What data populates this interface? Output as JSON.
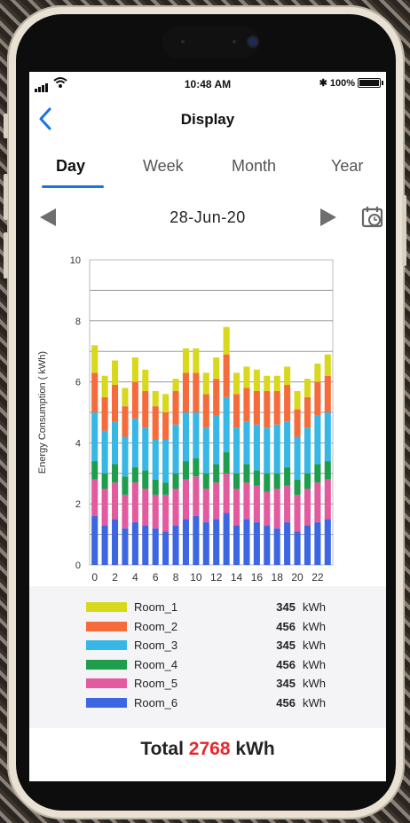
{
  "status": {
    "time": "10:48 AM",
    "battery": "100%",
    "battery_level": 1.0
  },
  "header": {
    "title": "Display"
  },
  "tabs": [
    {
      "label": "Day",
      "active": true
    },
    {
      "label": "Week",
      "active": false
    },
    {
      "label": "Month",
      "active": false
    },
    {
      "label": "Year",
      "active": false
    }
  ],
  "date": {
    "label": "28-Jun-20"
  },
  "icons": {
    "back": "chevron-left-icon",
    "prev": "triangle-left-icon",
    "next": "triangle-right-icon",
    "calendar": "calendar-clock-icon"
  },
  "chart_data": {
    "type": "bar",
    "stacked": true,
    "ylabel": "Energy Consumption ( kWh)",
    "ylim": [
      0,
      10
    ],
    "yticks": [
      0,
      2,
      4,
      6,
      8,
      10
    ],
    "xtick_labels": [
      "0",
      "2",
      "4",
      "6",
      "8",
      "10",
      "12",
      "14",
      "16",
      "18",
      "20",
      "22"
    ],
    "grid": true,
    "categories": [
      0,
      1,
      2,
      3,
      4,
      5,
      6,
      7,
      8,
      9,
      10,
      11,
      12,
      13,
      14,
      15,
      16,
      17,
      18,
      19,
      20,
      21,
      22,
      23
    ],
    "series": [
      {
        "name": "Room_6",
        "color": "#3d66e3",
        "values": [
          1.6,
          1.3,
          1.5,
          1.2,
          1.4,
          1.3,
          1.2,
          1.1,
          1.3,
          1.5,
          1.6,
          1.4,
          1.5,
          1.7,
          1.3,
          1.5,
          1.4,
          1.3,
          1.2,
          1.4,
          1.1,
          1.3,
          1.4,
          1.5
        ]
      },
      {
        "name": "Room_5",
        "color": "#e35a9e",
        "values": [
          1.2,
          1.2,
          1.2,
          1.1,
          1.3,
          1.2,
          1.1,
          1.2,
          1.2,
          1.3,
          1.3,
          1.1,
          1.2,
          1.3,
          1.2,
          1.2,
          1.2,
          1.1,
          1.3,
          1.2,
          1.2,
          1.2,
          1.3,
          1.3
        ]
      },
      {
        "name": "Room_4",
        "color": "#1e9e4d",
        "values": [
          0.6,
          0.5,
          0.6,
          0.6,
          0.5,
          0.6,
          0.5,
          0.4,
          0.5,
          0.6,
          0.6,
          0.5,
          0.6,
          0.7,
          0.5,
          0.6,
          0.5,
          0.6,
          0.5,
          0.6,
          0.5,
          0.5,
          0.6,
          0.6
        ]
      },
      {
        "name": "Room_3",
        "color": "#36b7e6",
        "values": [
          1.6,
          1.4,
          1.4,
          1.3,
          1.6,
          1.4,
          1.3,
          1.4,
          1.6,
          1.6,
          1.5,
          1.5,
          1.6,
          1.8,
          1.5,
          1.4,
          1.5,
          1.5,
          1.6,
          1.5,
          1.4,
          1.5,
          1.6,
          1.6
        ]
      },
      {
        "name": "Room_2",
        "color": "#f56b3c",
        "values": [
          1.3,
          1.1,
          1.2,
          1.0,
          1.2,
          1.2,
          1.1,
          0.9,
          1.1,
          1.3,
          1.3,
          1.1,
          1.2,
          1.4,
          1.1,
          1.1,
          1.1,
          1.2,
          1.1,
          1.2,
          0.9,
          1.0,
          1.1,
          1.2
        ]
      },
      {
        "name": "Room_1",
        "color": "#d8d81c",
        "values": [
          0.9,
          0.7,
          0.8,
          0.6,
          0.8,
          0.7,
          0.5,
          0.6,
          0.4,
          0.8,
          0.8,
          0.7,
          0.7,
          0.9,
          0.7,
          0.7,
          0.7,
          0.5,
          0.5,
          0.6,
          0.6,
          0.6,
          0.6,
          0.7
        ]
      }
    ]
  },
  "legend": [
    {
      "name": "Room_1",
      "color": "#d8d81c",
      "value": "345",
      "unit": "kWh"
    },
    {
      "name": "Room_2",
      "color": "#f56b3c",
      "value": "456",
      "unit": "kWh"
    },
    {
      "name": "Room_3",
      "color": "#36b7e6",
      "value": "345",
      "unit": "kWh"
    },
    {
      "name": "Room_4",
      "color": "#1e9e4d",
      "value": "456",
      "unit": "kWh"
    },
    {
      "name": "Room_5",
      "color": "#e35a9e",
      "value": "345",
      "unit": "kWh"
    },
    {
      "name": "Room_6",
      "color": "#3d66e3",
      "value": "456",
      "unit": "kWh"
    }
  ],
  "total": {
    "label": "Total",
    "value": "2768",
    "unit": "kWh"
  }
}
